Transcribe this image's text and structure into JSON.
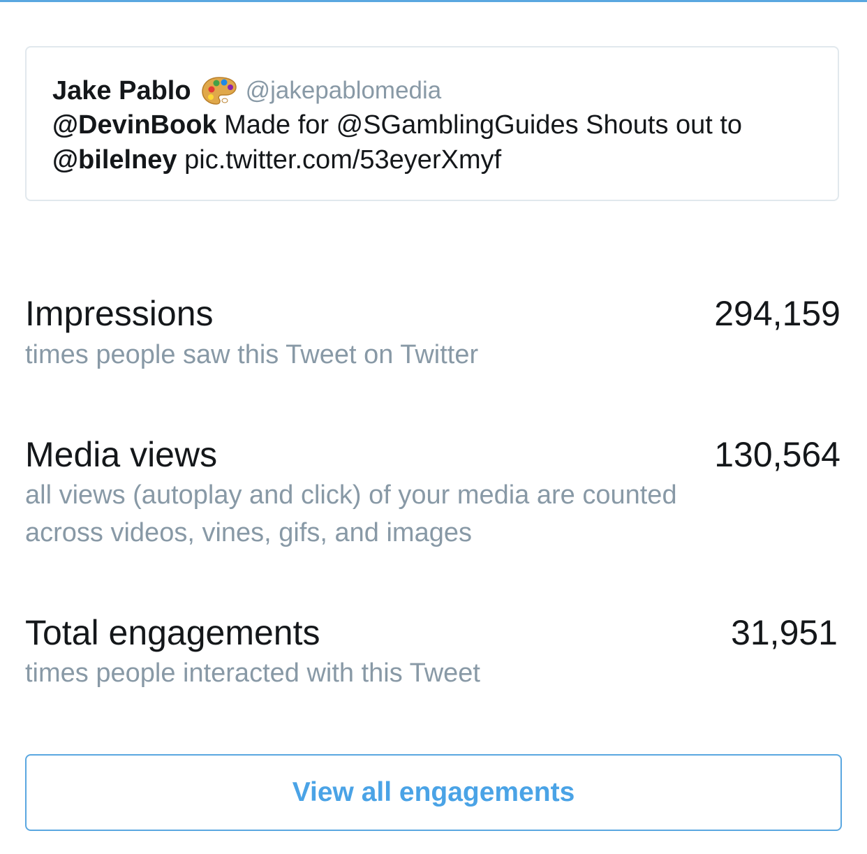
{
  "tweet": {
    "author_name": "Jake Pablo",
    "author_emoji_icon": "artist-palette-icon",
    "author_handle": "@jakepablomedia",
    "mention_1": "@DevinBook",
    "text_1": " Made for @SGamblingGuides Shouts out to",
    "mention_2": "@bilelney",
    "text_2": " pic.twitter.com/53eyerXmyf"
  },
  "metrics": [
    {
      "title": "Impressions",
      "value": "294,159",
      "description": "times people saw this Tweet on Twitter"
    },
    {
      "title": "Media views",
      "value": "130,564",
      "description_line1": "all views (autoplay and click) of your media are counted",
      "description_line2": "across videos, vines, gifs, and images"
    },
    {
      "title": "Total engagements",
      "value": "31,951",
      "description": "times people interacted with this Tweet"
    }
  ],
  "actions": {
    "view_all_label": "View all engagements"
  },
  "colors": {
    "accent": "#4aa3e6",
    "muted_text": "#8899a6",
    "primary_text": "#14171a",
    "card_border": "#e1e8ed"
  }
}
